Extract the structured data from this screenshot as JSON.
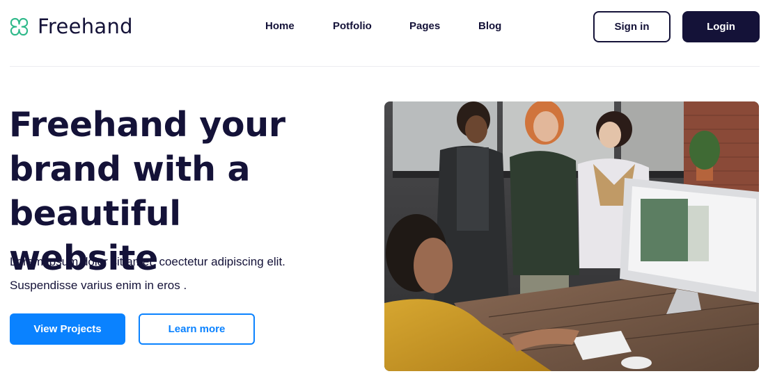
{
  "brand": {
    "name": "Freehand",
    "logo_icon": "clover-icon",
    "accent_color": "#2fb98a"
  },
  "nav": {
    "items": [
      "Home",
      "Potfolio",
      "Pages",
      "Blog"
    ]
  },
  "auth": {
    "signin_label": "Sign in",
    "login_label": "Login"
  },
  "hero": {
    "title": "Freehand your brand with a beautiful website",
    "subtitle": "Lorem ipsum dolor sit amet, coectetur adipiscing elit. Suspendisse varius enim in eros .",
    "primary_cta": "View Projects",
    "secondary_cta": "Learn more",
    "image": "team-office-photo"
  },
  "colors": {
    "primary": "#0a82ff",
    "dark": "#141238",
    "divider": "#ececf0"
  }
}
